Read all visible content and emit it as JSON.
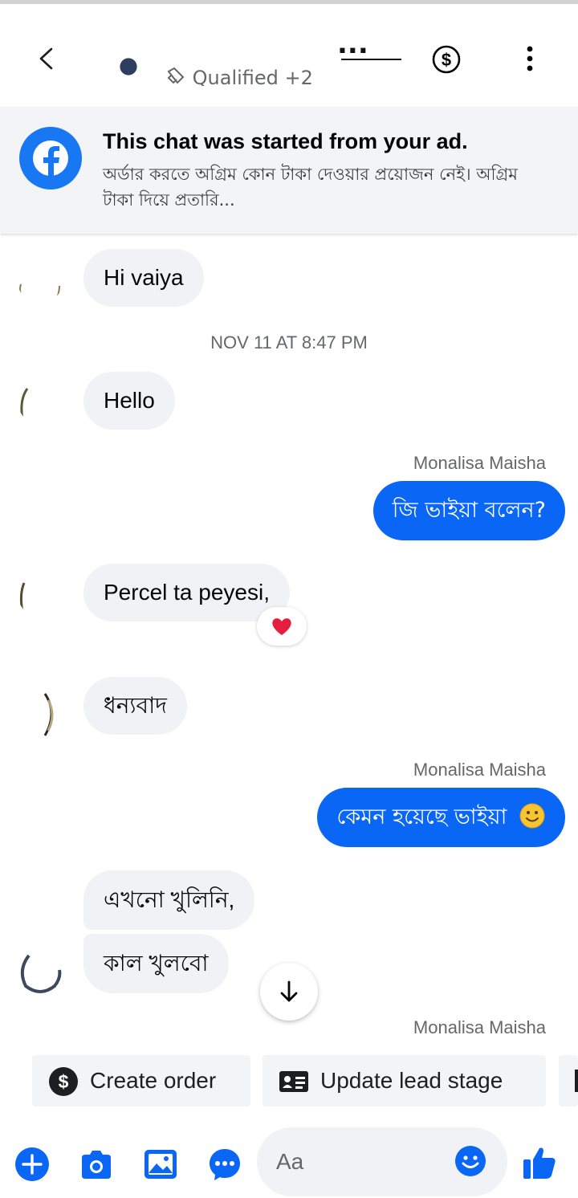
{
  "header": {
    "title": "...",
    "subtitle": "Qualified +2",
    "back_icon": "chevron-left-icon",
    "dollar_icon": "dollar-circle-icon",
    "more_icon": "more-vertical-icon"
  },
  "ad_banner": {
    "title": "This chat was started from your ad.",
    "text": "অর্ডার করতে অগ্রিম কোন টাকা দেওয়ার প্রয়োজন নেই। অগ্রিম টাকা দিয়ে প্রতারি..."
  },
  "timestamp": "NOV 11 AT 8:47 PM",
  "messages": [
    {
      "from": "in",
      "text": "Hi vaiya"
    },
    {
      "from": "in",
      "text": "Hello"
    },
    {
      "from": "out",
      "sender": "Monalisa Maisha",
      "text": "জি ভাইয়া বলেন?"
    },
    {
      "from": "in",
      "text": "Percel ta peyesi,",
      "reaction": "❤"
    },
    {
      "from": "in",
      "text": "ধন্যবাদ"
    },
    {
      "from": "out",
      "sender": "Monalisa Maisha",
      "text": "কেমন হয়েছে ভাইয়া"
    },
    {
      "from": "in",
      "text": "এখনো খুলিনি,"
    },
    {
      "from": "in",
      "text": "কাল খুলবো"
    },
    {
      "from": "out",
      "sender": "Monalisa Maisha",
      "text": ""
    }
  ],
  "quick_actions": {
    "create_order": "Create order",
    "update_lead_stage": "Update lead stage"
  },
  "composer": {
    "placeholder": "Aa"
  },
  "colors": {
    "accent": "#0a66f5",
    "incoming_bubble": "#f0f2f5",
    "facebook_blue": "#1877f2"
  }
}
